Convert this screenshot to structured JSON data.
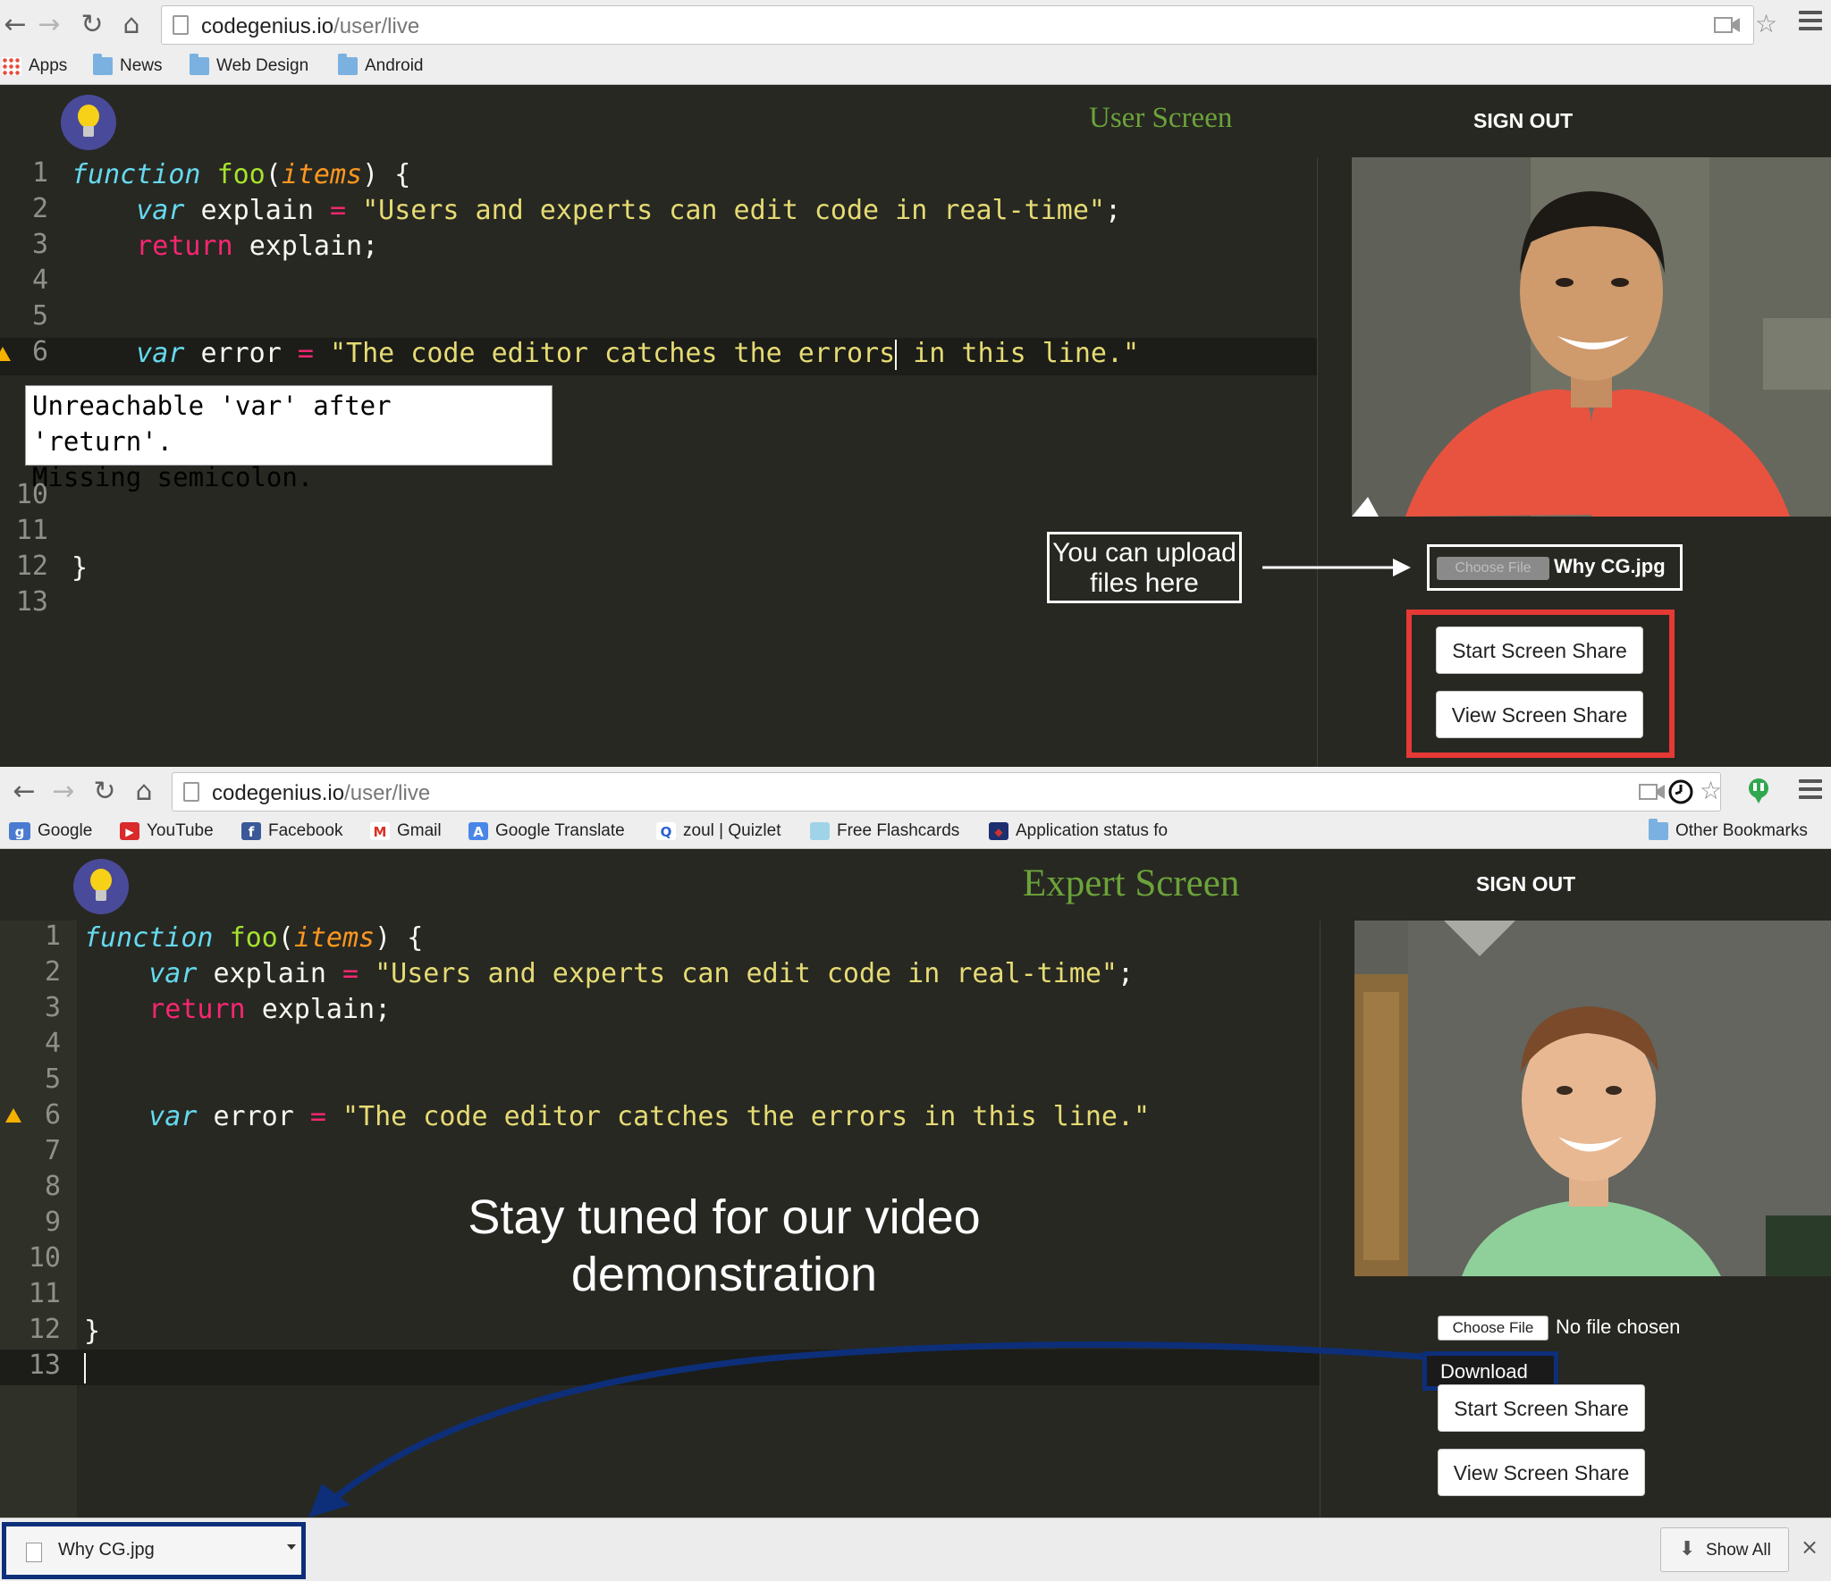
{
  "top_browser": {
    "url_host": "codegenius.io",
    "url_path": "/user/live",
    "bookmarks": [
      "Apps",
      "News",
      "Web Design",
      "Android"
    ]
  },
  "bottom_browser": {
    "url_host": "codegenius.io",
    "url_path": "/user/live",
    "bookmarks": [
      "Google",
      "YouTube",
      "Facebook",
      "Gmail",
      "Google Translate",
      "zoul | Quizlet",
      "Free Flashcards",
      "Application status fo",
      "Other Bookmarks"
    ]
  },
  "user_screen": {
    "title": "User Screen",
    "signout": "SIGN OUT",
    "line_numbers": [
      "1",
      "2",
      "3",
      "4",
      "5",
      "6",
      "10",
      "11",
      "12",
      "13"
    ],
    "code": {
      "l1_fn": "function",
      "l1_name": "foo",
      "l1_param": "items",
      "l2_var": "var",
      "l2_name": "explain",
      "l2_str": "\"Users and experts can edit code in real-time\"",
      "l3_ret": "return",
      "l3_rest": "explain;",
      "l6_var": "var",
      "l6_name": "error",
      "l6_str_a": "\"The code editor catches the errors",
      "l6_str_b": " in this line.\"",
      "l12": "}"
    },
    "tooltip_lines": [
      "Unreachable 'var' after 'return'.",
      "Missing semicolon."
    ],
    "upload_annotation": "You can upload files here",
    "choose_file_label": "Choose File",
    "chosen_file": "Why CG.jpg",
    "start_share": "Start Screen Share",
    "view_share": "View Screen Share"
  },
  "expert_screen": {
    "title": "Expert Screen",
    "signout": "SIGN OUT",
    "line_numbers": [
      "1",
      "2",
      "3",
      "4",
      "5",
      "6",
      "7",
      "8",
      "9",
      "10",
      "11",
      "12",
      "13"
    ],
    "annotation": "Stay tuned for our video demonstration",
    "choose_file_label": "Choose File",
    "no_file": "No file chosen",
    "download": "Download",
    "start_share": "Start Screen Share",
    "view_share": "View Screen Share"
  },
  "downloads": {
    "file": "Why CG.jpg",
    "show_all": "Show All"
  },
  "colors": {
    "editor_bg": "#272822",
    "title_green": "#6ca33a",
    "highlight_red": "#e53935",
    "highlight_blue": "#0d2f7a"
  }
}
